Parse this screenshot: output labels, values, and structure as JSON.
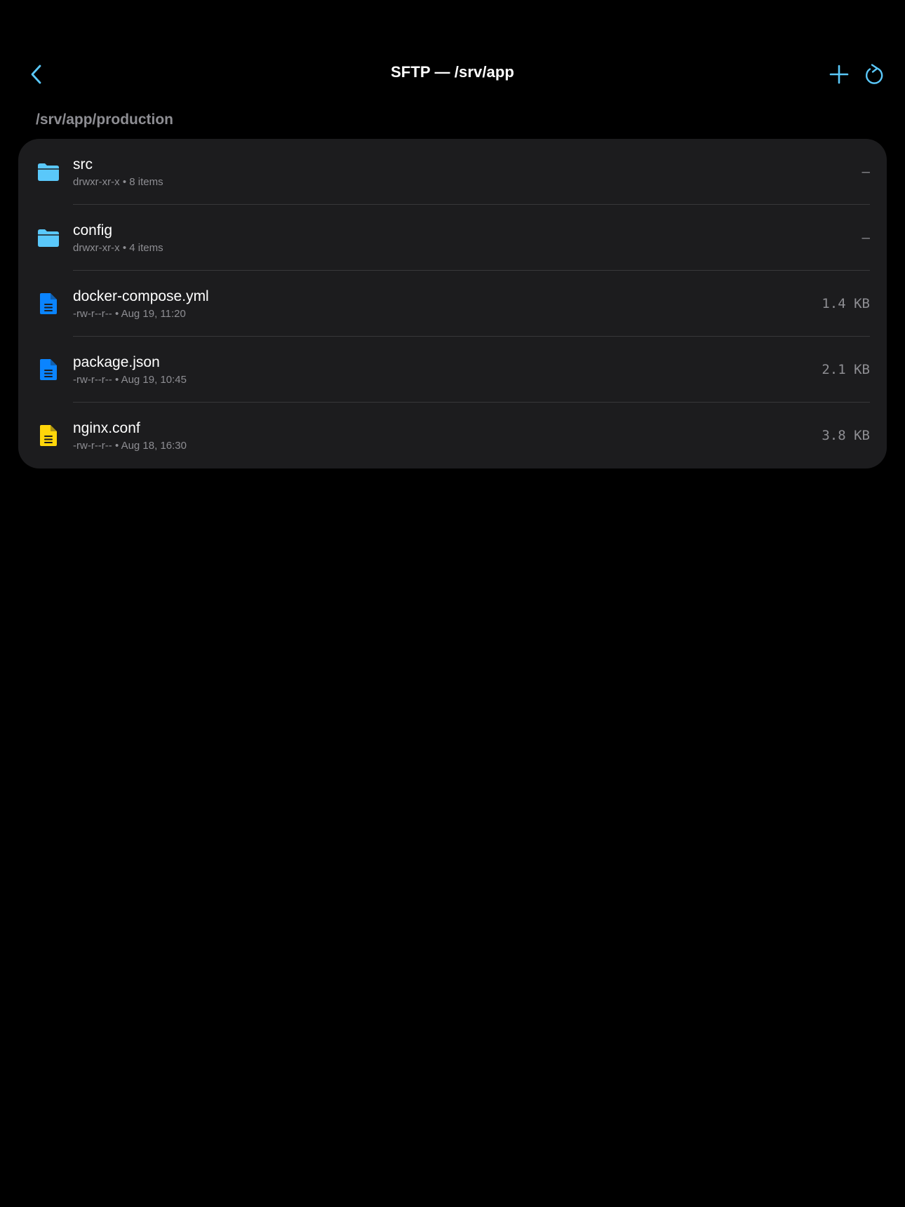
{
  "nav": {
    "title": "SFTP — /srv/app",
    "back_icon": "chevron-left-icon",
    "add_icon": "plus-icon",
    "refresh_icon": "refresh-icon",
    "accent_color": "#5ac8fa"
  },
  "section": {
    "path": "/srv/app/production"
  },
  "files": [
    {
      "name": "src",
      "permissions": "drwxr-xr-x",
      "detail": "8 items",
      "size": "–",
      "kind": "folder",
      "icon": "folder-icon",
      "icon_color": "#5ac8fa"
    },
    {
      "name": "config",
      "permissions": "drwxr-xr-x",
      "detail": "4 items",
      "size": "–",
      "kind": "folder",
      "icon": "folder-icon",
      "icon_color": "#5ac8fa"
    },
    {
      "name": "docker-compose.yml",
      "permissions": "-rw-r--r--",
      "detail": "Aug 19, 11:20",
      "size": "1.4 KB",
      "kind": "document",
      "icon": "document-icon",
      "icon_color": "#0a84ff"
    },
    {
      "name": "package.json",
      "permissions": "-rw-r--r--",
      "detail": "Aug 19, 10:45",
      "size": "2.1 KB",
      "kind": "document",
      "icon": "document-icon",
      "icon_color": "#0a84ff"
    },
    {
      "name": "nginx.conf",
      "permissions": "-rw-r--r--",
      "detail": "Aug 18, 16:30",
      "size": "3.8 KB",
      "kind": "document",
      "icon": "document-icon",
      "icon_color": "#ffd60a"
    }
  ]
}
